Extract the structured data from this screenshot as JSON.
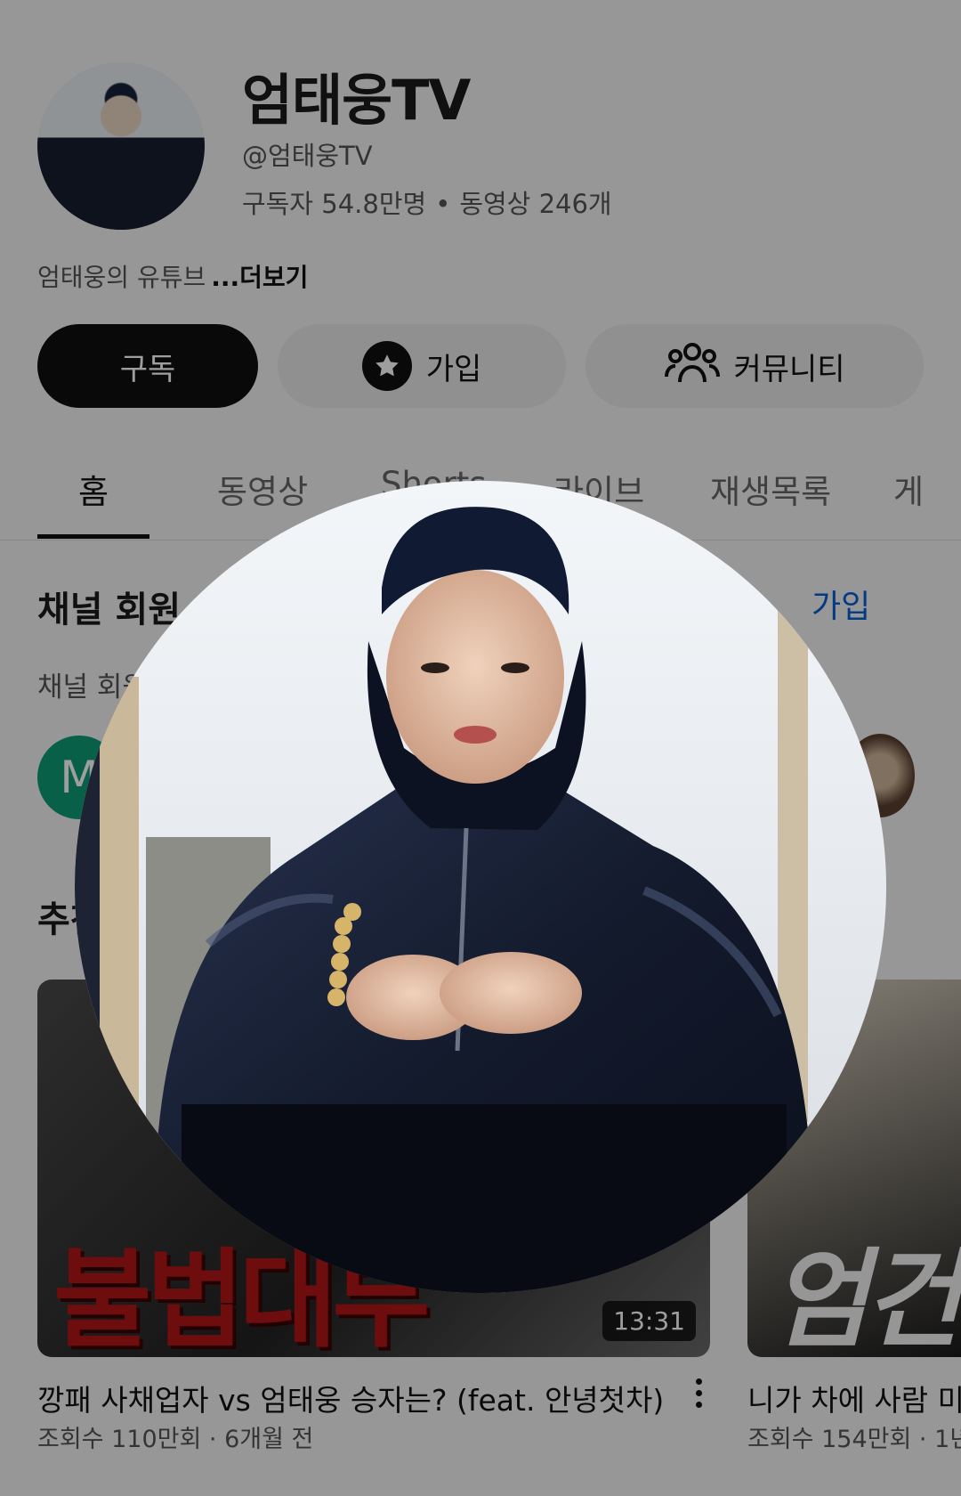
{
  "channel": {
    "title": "엄태웅TV",
    "handle": "@엄태웅TV",
    "subscribers": "구독자 54.8만명",
    "videos": "동영상 246개",
    "description": "엄태웅의 유튜브",
    "more_label": "...더보기"
  },
  "actions": {
    "subscribe_label": "구독",
    "join_label": "가입",
    "community_label": "커뮤니티"
  },
  "tabs": [
    "홈",
    "동영상",
    "Shorts",
    "라이브",
    "재생목록",
    "게"
  ],
  "membership": {
    "title": "채널 회원",
    "join_label": "가입",
    "subtitle": "채널 회원",
    "member_initial": "M"
  },
  "recommended": {
    "title": "추천"
  },
  "videos": [
    {
      "thumb_text": "불법대부",
      "duration": "13:31",
      "title": "깡패 사채업자 vs 엄태웅 승자는? (feat. 안녕첫차)",
      "meta": "조회수 110만회 · 6개월 전"
    },
    {
      "thumb_text": "엄건",
      "title": "니가 차에 사람 미",
      "meta": "조회수 154만회 · 1년"
    }
  ],
  "icons": [
    "star-icon",
    "people-icon",
    "more-vert-icon"
  ],
  "colors": {
    "subscribe_bg": "#0f0f0f",
    "link_blue": "#065fd4",
    "member_green": "#0d9c74"
  }
}
